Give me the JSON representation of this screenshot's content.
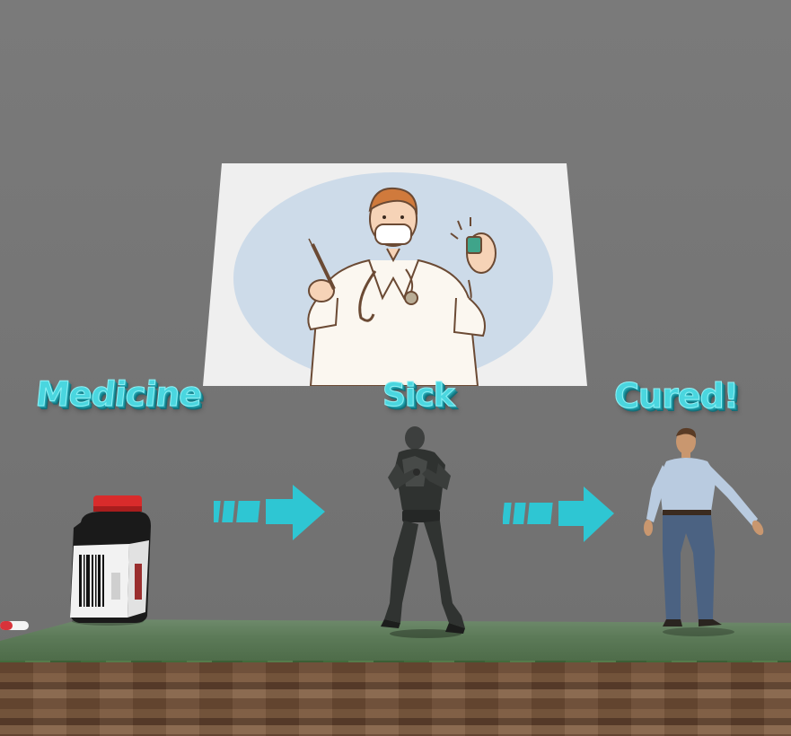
{
  "scene": {
    "labels": {
      "medicine": "Medicine",
      "sick": "Sick",
      "cured": "Cured!"
    },
    "icons": {
      "poster": "doctor-syringe-illustration",
      "bottle": "medicine-bottle",
      "arrow": "dashed-arrow-right",
      "sick_character": "zombie-character",
      "cured_character": "man-character"
    },
    "colors": {
      "label": "#4ad6df",
      "arrow": "#2ec6d3",
      "background": "#777777",
      "grass": "#5c7a58",
      "dirt": "#6a4a33"
    }
  }
}
